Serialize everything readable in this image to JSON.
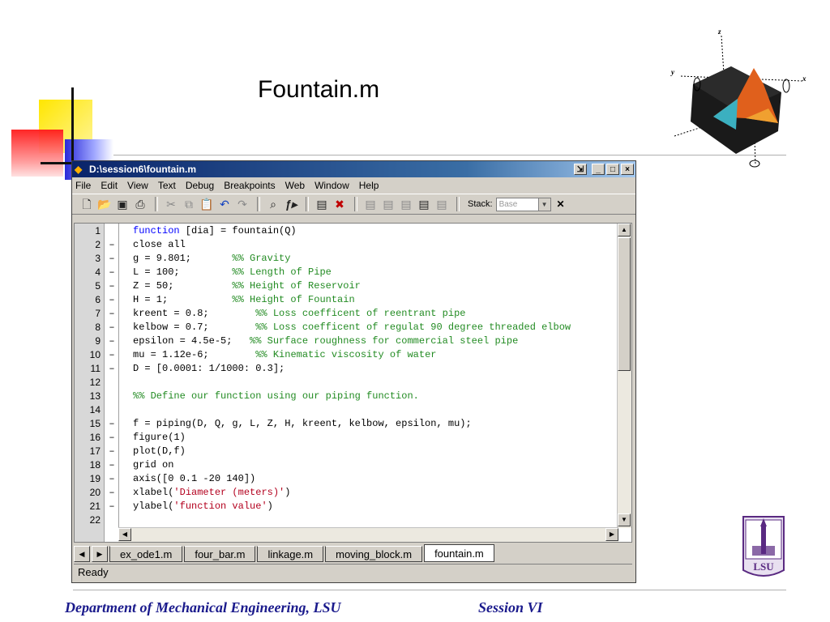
{
  "slide": {
    "title": "Fountain.m",
    "footer_left": "Department of Mechanical Engineering, LSU",
    "footer_right": "Session VI",
    "lsu_logo_text": "LSU"
  },
  "logo_axes": {
    "x": "x",
    "y": "y",
    "z": "z"
  },
  "window": {
    "title": "D:\\session6\\fountain.m",
    "menu": [
      "File",
      "Edit",
      "View",
      "Text",
      "Debug",
      "Breakpoints",
      "Web",
      "Window",
      "Help"
    ],
    "stack_label": "Stack:",
    "stack_value": "Base",
    "status": "Ready",
    "tabs": [
      "ex_ode1.m",
      "four_bar.m",
      "linkage.m",
      "moving_block.m",
      "fountain.m"
    ],
    "active_tab": "fountain.m"
  },
  "toolbar_icons": [
    "new-file-icon",
    "open-folder-icon",
    "save-icon",
    "print-icon",
    "cut-icon",
    "copy-icon",
    "paste-icon",
    "undo-icon",
    "redo-icon",
    "find-icon",
    "function-icon",
    "set-breakpoint-icon",
    "clear-breakpoint-icon",
    "step-icon",
    "step-in-icon",
    "step-out-icon",
    "continue-icon",
    "exit-debug-icon"
  ],
  "code": [
    {
      "n": "1",
      "bp": "",
      "code": "function [dia] = fountain(Q)",
      "kw": "function",
      "rest": " [dia] = fountain(Q)",
      "comment": ""
    },
    {
      "n": "2",
      "bp": "–",
      "code": "close all",
      "comment": ""
    },
    {
      "n": "3",
      "bp": "–",
      "code": "g = 9.801;       ",
      "comment": "%% Gravity"
    },
    {
      "n": "4",
      "bp": "–",
      "code": "L = 100;         ",
      "comment": "%% Length of Pipe"
    },
    {
      "n": "5",
      "bp": "–",
      "code": "Z = 50;          ",
      "comment": "%% Height of Reservoir"
    },
    {
      "n": "6",
      "bp": "–",
      "code": "H = 1;           ",
      "comment": "%% Height of Fountain"
    },
    {
      "n": "7",
      "bp": "–",
      "code": "kreent = 0.8;        ",
      "comment": "%% Loss coefficent of reentrant pipe"
    },
    {
      "n": "8",
      "bp": "–",
      "code": "kelbow = 0.7;        ",
      "comment": "%% Loss coefficent of regulat 90 degree threaded elbow"
    },
    {
      "n": "9",
      "bp": "–",
      "code": "epsilon = 4.5e-5;   ",
      "comment": "%% Surface roughness for commercial steel pipe"
    },
    {
      "n": "10",
      "bp": "–",
      "code": "mu = 1.12e-6;        ",
      "comment": "%% Kinematic viscosity of water"
    },
    {
      "n": "11",
      "bp": "–",
      "code": "D = [0.0001: 1/1000: 0.3];",
      "comment": ""
    },
    {
      "n": "12",
      "bp": "",
      "code": "",
      "comment": ""
    },
    {
      "n": "13",
      "bp": "",
      "code": "",
      "comment": "%% Define our function using our piping function."
    },
    {
      "n": "14",
      "bp": "",
      "code": "",
      "comment": ""
    },
    {
      "n": "15",
      "bp": "–",
      "code": "f = piping(D, Q, g, L, Z, H, kreent, kelbow, epsilon, mu);",
      "comment": ""
    },
    {
      "n": "16",
      "bp": "–",
      "code": "figure(1)",
      "comment": ""
    },
    {
      "n": "17",
      "bp": "–",
      "code": "plot(D,f)",
      "comment": ""
    },
    {
      "n": "18",
      "bp": "–",
      "code": "grid on",
      "comment": ""
    },
    {
      "n": "19",
      "bp": "–",
      "code": "axis([0 0.1 -20 140])",
      "comment": ""
    },
    {
      "n": "20",
      "bp": "–",
      "code": "xlabel(",
      "str": "'Diameter (meters)'",
      "tail": ")",
      "comment": ""
    },
    {
      "n": "21",
      "bp": "–",
      "code": "ylabel(",
      "str": "'function value'",
      "tail": ")",
      "comment": ""
    },
    {
      "n": "22",
      "bp": "",
      "code": "",
      "comment": ""
    }
  ]
}
